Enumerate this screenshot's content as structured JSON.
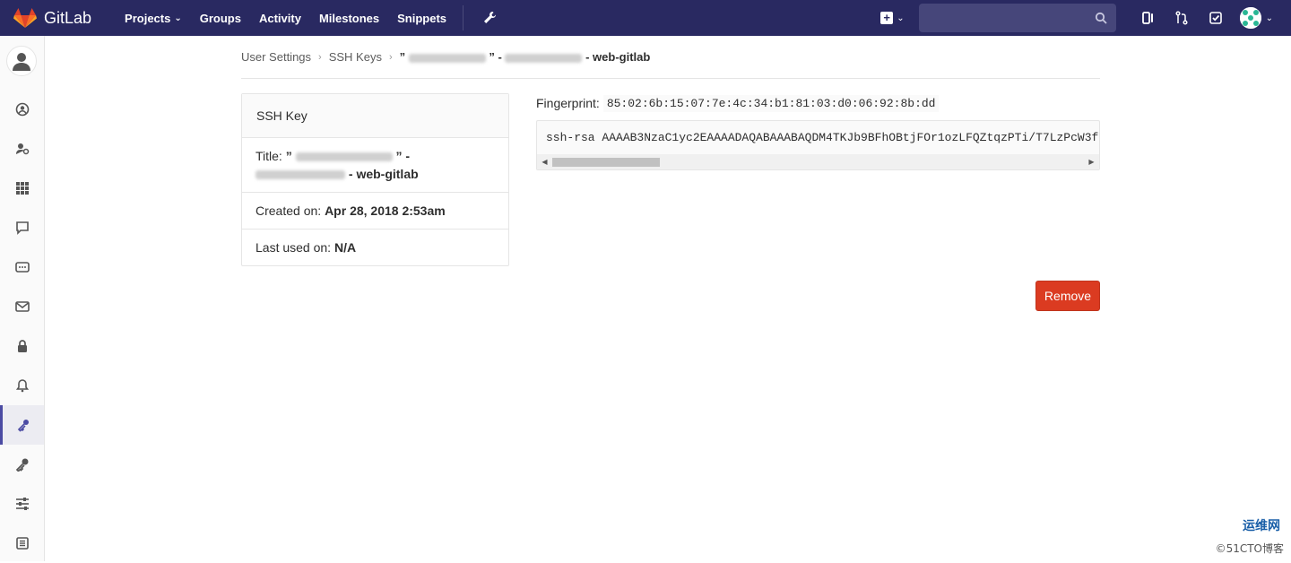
{
  "app": {
    "name": "GitLab"
  },
  "nav": {
    "links": [
      {
        "label": "Projects",
        "dropdown": true
      },
      {
        "label": "Groups"
      },
      {
        "label": "Activity"
      },
      {
        "label": "Milestones"
      },
      {
        "label": "Snippets"
      }
    ],
    "search_placeholder": ""
  },
  "breadcrumb": {
    "items": [
      "User Settings",
      "SSH Keys"
    ],
    "current_open": "”",
    "current_mid": "” -",
    "current_end": "- web-gitlab"
  },
  "panel": {
    "heading": "SSH Key",
    "title_label": "Title:",
    "title_open": "”",
    "title_close": "” -",
    "title_suffix": "- web-gitlab",
    "created_label": "Created on:",
    "created_value": "Apr 28, 2018 2:53am",
    "last_used_label": "Last used on:",
    "last_used_value": "N/A"
  },
  "fingerprint": {
    "label": "Fingerprint:",
    "value": "85:02:6b:15:07:7e:4c:34:b1:81:03:d0:06:92:8b:dd"
  },
  "key": {
    "text": "ssh-rsa AAAAB3NzaC1yc2EAAAADAQABAAABAQDM4TKJb9BFhOBtjFOr1ozLFQZtqzPTi/T7LzPcW3f"
  },
  "actions": {
    "remove_label": "Remove"
  },
  "watermark": {
    "text": "运维网",
    "sub": "©51CTO博客"
  },
  "colors": {
    "navbar": "#292961",
    "danger": "#db3b21",
    "active_sidebar": "#4b4ba3"
  },
  "icons": {
    "sidebar": [
      "profile-icon",
      "account-icon",
      "applications-icon",
      "chat-icon",
      "emails-icon",
      "mail-icon",
      "lock-icon",
      "bell-icon",
      "key-icon",
      "wrench-key-icon",
      "preferences-icon",
      "log-icon"
    ]
  }
}
